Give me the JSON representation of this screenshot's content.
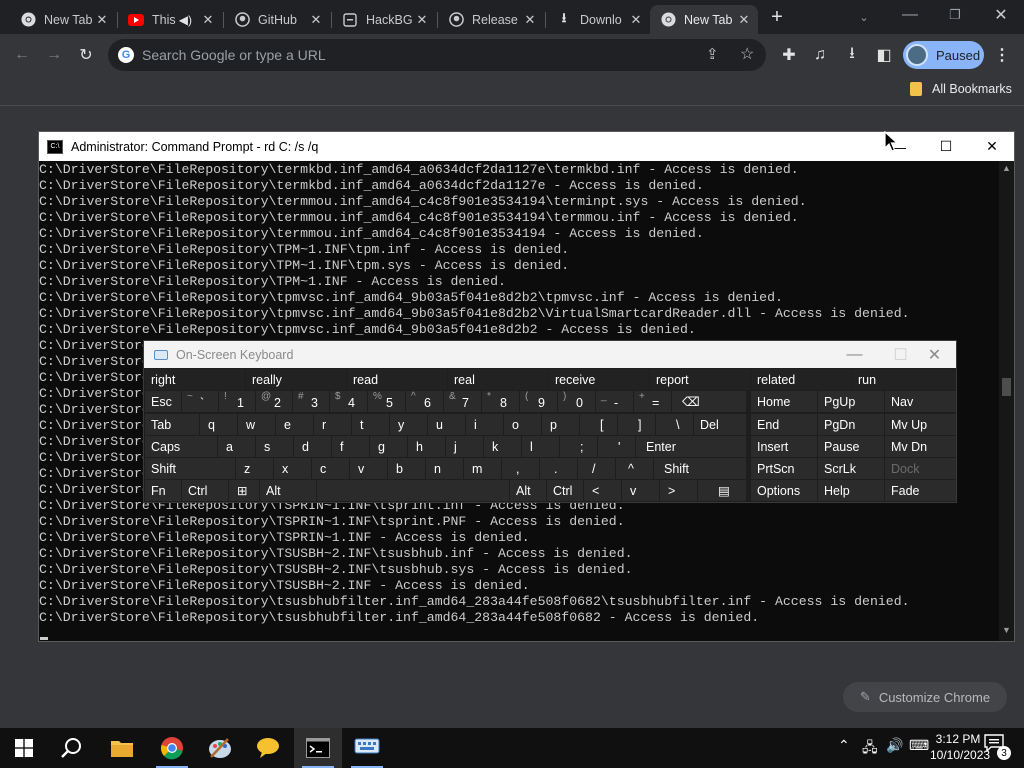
{
  "browser": {
    "tabs": [
      {
        "title": "New Tab",
        "icon": "chrome-icon"
      },
      {
        "title": "This",
        "icon": "youtube-icon"
      },
      {
        "title": "GitHub",
        "icon": "github-icon"
      },
      {
        "title": "HackBG",
        "icon": "page-icon"
      },
      {
        "title": "Release",
        "icon": "github-icon"
      },
      {
        "title": "Downlo",
        "icon": "download-icon"
      },
      {
        "title": "New Tab",
        "icon": "chrome-icon",
        "active": true
      }
    ],
    "omnibox_placeholder": "Search Google or type a URL",
    "profile_label": "Paused",
    "bookmarks_label": "All Bookmarks",
    "customize_label": "Customize Chrome"
  },
  "cmd": {
    "title": "Administrator: Command Prompt - rd  C: /s /q",
    "lines": [
      "C:\\DriverStore\\FileRepository\\termkbd.inf_amd64_a0634dcf2da1127e\\termkbd.inf - Access is denied.",
      "C:\\DriverStore\\FileRepository\\termkbd.inf_amd64_a0634dcf2da1127e - Access is denied.",
      "C:\\DriverStore\\FileRepository\\termmou.inf_amd64_c4c8f901e3534194\\terminpt.sys - Access is denied.",
      "C:\\DriverStore\\FileRepository\\termmou.inf_amd64_c4c8f901e3534194\\termmou.inf - Access is denied.",
      "C:\\DriverStore\\FileRepository\\termmou.inf_amd64_c4c8f901e3534194 - Access is denied.",
      "C:\\DriverStore\\FileRepository\\TPM~1.INF\\tpm.inf - Access is denied.",
      "C:\\DriverStore\\FileRepository\\TPM~1.INF\\tpm.sys - Access is denied.",
      "C:\\DriverStore\\FileRepository\\TPM~1.INF - Access is denied.",
      "C:\\DriverStore\\FileRepository\\tpmvsc.inf_amd64_9b03a5f041e8d2b2\\tpmvsc.inf - Access is denied.",
      "C:\\DriverStore\\FileRepository\\tpmvsc.inf_amd64_9b03a5f041e8d2b2\\VirtualSmartcardReader.dll - Access is denied.",
      "C:\\DriverStore\\FileRepository\\tpmvsc.inf_amd64_9b03a5f041e8d2b2 - Access is denied.",
      "C:\\DriverStore",
      "C:\\DriverStore",
      "C:\\DriverStore",
      "C:\\DriverStore",
      "C:\\DriverStore",
      "C:\\DriverStore",
      "C:\\DriverStore",
      "C:\\DriverStore",
      "C:\\DriverStore",
      "C:\\DriverStore",
      "C:\\DriverStore\\FileRepository\\TSPRIN~1.INF\\tsprint.inf - Access is denied.",
      "C:\\DriverStore\\FileRepository\\TSPRIN~1.INF\\tsprint.PNF - Access is denied.",
      "C:\\DriverStore\\FileRepository\\TSPRIN~1.INF - Access is denied.",
      "C:\\DriverStore\\FileRepository\\TSUSBH~2.INF\\tsusbhub.inf - Access is denied.",
      "C:\\DriverStore\\FileRepository\\TSUSBH~2.INF\\tsusbhub.sys - Access is denied.",
      "C:\\DriverStore\\FileRepository\\TSUSBH~2.INF - Access is denied.",
      "C:\\DriverStore\\FileRepository\\tsusbhubfilter.inf_amd64_283a44fe508f0682\\tsusbhubfilter.inf - Access is denied.",
      "C:\\DriverStore\\FileRepository\\tsusbhubfilter.inf_amd64_283a44fe508f0682 - Access is denied."
    ]
  },
  "osk": {
    "title": "On-Screen Keyboard",
    "suggestions": [
      "right",
      "really",
      "read",
      "real",
      "receive",
      "report",
      "related",
      "run"
    ],
    "nav_keys": [
      [
        "Home",
        "PgUp",
        "Nav"
      ],
      [
        "End",
        "PgDn",
        "Mv Up"
      ],
      [
        "Insert",
        "Pause",
        "Mv Dn"
      ],
      [
        "PrtScn",
        "ScrLk",
        "Dock"
      ],
      [
        "Options",
        "Help",
        "Fade"
      ]
    ],
    "row1": [
      {
        "label": "Esc"
      },
      {
        "shift": "~",
        "main": "`"
      },
      {
        "shift": "!",
        "main": "1"
      },
      {
        "shift": "@",
        "main": "2"
      },
      {
        "shift": "#",
        "main": "3"
      },
      {
        "shift": "$",
        "main": "4"
      },
      {
        "shift": "%",
        "main": "5"
      },
      {
        "shift": "^",
        "main": "6"
      },
      {
        "shift": "&",
        "main": "7"
      },
      {
        "shift": "*",
        "main": "8"
      },
      {
        "shift": "(",
        "main": "9"
      },
      {
        "shift": ")",
        "main": "0"
      },
      {
        "shift": "_",
        "main": "-"
      },
      {
        "shift": "+",
        "main": "="
      },
      {
        "label": "⌫"
      }
    ],
    "row2": [
      "Tab",
      "q",
      "w",
      "e",
      "r",
      "t",
      "y",
      "u",
      "i",
      "o",
      "p",
      "[",
      "]",
      "\\",
      "Del"
    ],
    "row3": [
      "Caps",
      "a",
      "s",
      "d",
      "f",
      "g",
      "h",
      "j",
      "k",
      "l",
      ";",
      "'",
      "Enter"
    ],
    "row4": [
      "Shift",
      "z",
      "x",
      "c",
      "v",
      "b",
      "n",
      "m",
      ",",
      ".",
      "/",
      "^",
      "Shift"
    ],
    "row5": [
      "Fn",
      "Ctrl",
      "⊞",
      "Alt",
      "",
      "Alt",
      "Ctrl",
      "<",
      "v",
      ">",
      "▤"
    ]
  },
  "taskbar": {
    "time": "3:12 PM",
    "date": "10/10/2023",
    "notification_count": "3"
  }
}
